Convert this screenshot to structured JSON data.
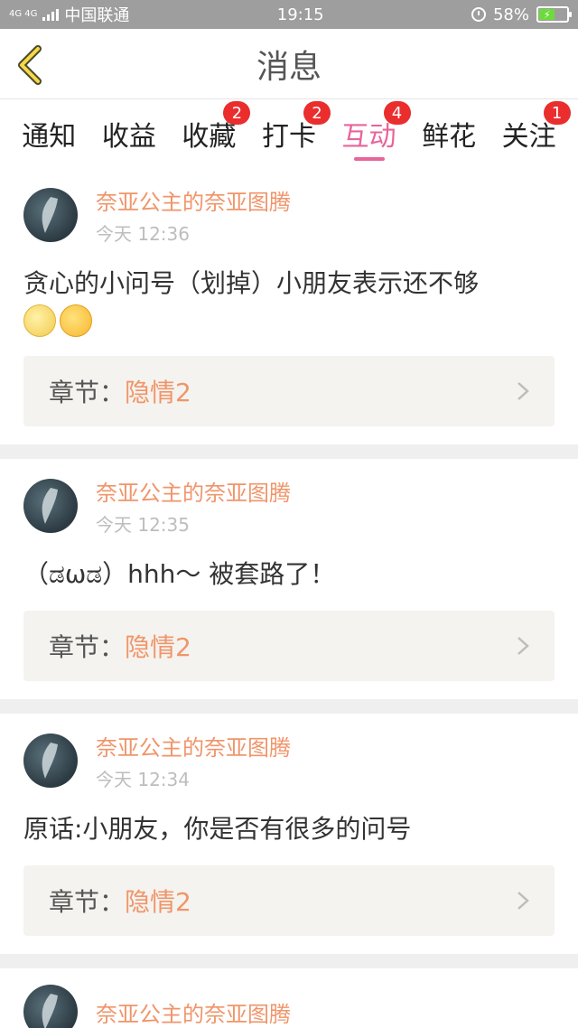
{
  "status_bar": {
    "network": "4G 4G",
    "carrier": "中国联通",
    "time": "19:15",
    "battery": "58%"
  },
  "header": {
    "title": "消息"
  },
  "tabs": [
    {
      "label": "通知",
      "badge": null
    },
    {
      "label": "收益",
      "badge": null
    },
    {
      "label": "收藏",
      "badge": "2"
    },
    {
      "label": "打卡",
      "badge": "2"
    },
    {
      "label": "互动",
      "badge": "4",
      "active": true
    },
    {
      "label": "鲜花",
      "badge": null
    },
    {
      "label": "关注",
      "badge": "1"
    }
  ],
  "messages": [
    {
      "name": "奈亚公主的奈亚图腾",
      "time": "今天 12:36",
      "content": "贪心的小问号（划掉）小朋友表示还不够",
      "emojis": [
        "moon-face",
        "laughing-tears"
      ],
      "chapter_label": "章节：",
      "chapter_value": "隐情2"
    },
    {
      "name": "奈亚公主的奈亚图腾",
      "time": "今天 12:35",
      "content": "（ಡωಡ）hhh～ 被套路了！",
      "chapter_label": "章节：",
      "chapter_value": "隐情2"
    },
    {
      "name": "奈亚公主的奈亚图腾",
      "time": "今天 12:34",
      "content": "原话:小朋友，你是否有很多的问号",
      "chapter_label": "章节：",
      "chapter_value": "隐情2"
    },
    {
      "name": "奈亚公主的奈亚图腾"
    }
  ],
  "colors": {
    "accent": "#e8649a",
    "name": "#f0956a",
    "badge": "#ea2d2d"
  }
}
